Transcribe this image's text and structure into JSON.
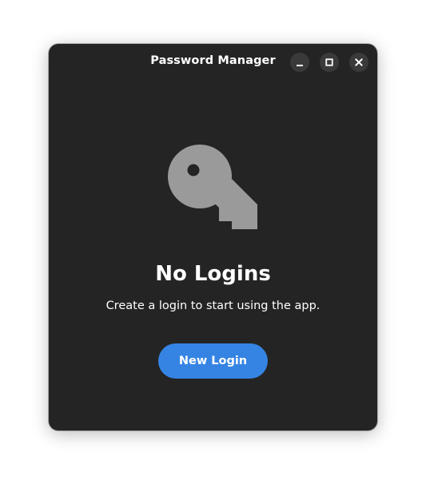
{
  "window": {
    "title": "Password Manager",
    "controls": {
      "minimize_icon": "minimize-icon",
      "maximize_icon": "maximize-icon",
      "close_icon": "close-icon"
    }
  },
  "status_page": {
    "icon": "key-icon",
    "title": "No Logins",
    "description": "Create a login to start using the app.",
    "button_label": "New Login"
  },
  "colors": {
    "window_background": "#242424",
    "accent": "#3584e4",
    "icon": "#9a9a9a",
    "window_button": "#3a3a3a"
  }
}
